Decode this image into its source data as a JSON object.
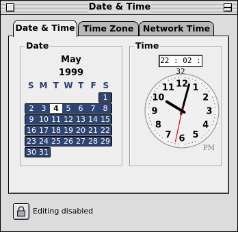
{
  "window": {
    "title": "Date & Time"
  },
  "tabs": [
    {
      "label": "Date & Time",
      "active": true
    },
    {
      "label": "Time Zone",
      "active": false
    },
    {
      "label": "Network Time",
      "active": false
    }
  ],
  "date": {
    "group_label": "Date",
    "month": "May",
    "year": "1999",
    "weekday_headers": [
      "S",
      "M",
      "T",
      "W",
      "T",
      "F",
      "S"
    ],
    "selected_day": "4",
    "weeks": [
      [
        "",
        "",
        "",
        "",
        "",
        "",
        "1"
      ],
      [
        "2",
        "3",
        "4",
        "5",
        "6",
        "7",
        "8"
      ],
      [
        "9",
        "10",
        "11",
        "12",
        "13",
        "14",
        "15"
      ],
      [
        "16",
        "17",
        "18",
        "19",
        "20",
        "21",
        "22"
      ],
      [
        "23",
        "24",
        "25",
        "26",
        "27",
        "28",
        "29"
      ],
      [
        "30",
        "31",
        "",
        "",
        "",
        "",
        ""
      ]
    ]
  },
  "time": {
    "group_label": "Time",
    "digital": "22 : 02 : 32",
    "ampm": "PM",
    "clock_numbers": [
      "12",
      "1",
      "2",
      "3",
      "4",
      "5",
      "6",
      "7",
      "8",
      "9",
      "10",
      "11"
    ],
    "hour": 22,
    "minute": 2,
    "second": 32
  },
  "footer": {
    "lock_icon": "lock-icon",
    "status": "Editing disabled"
  },
  "colors": {
    "calendar_row": "#2d4575",
    "second_hand": "#e00000"
  }
}
